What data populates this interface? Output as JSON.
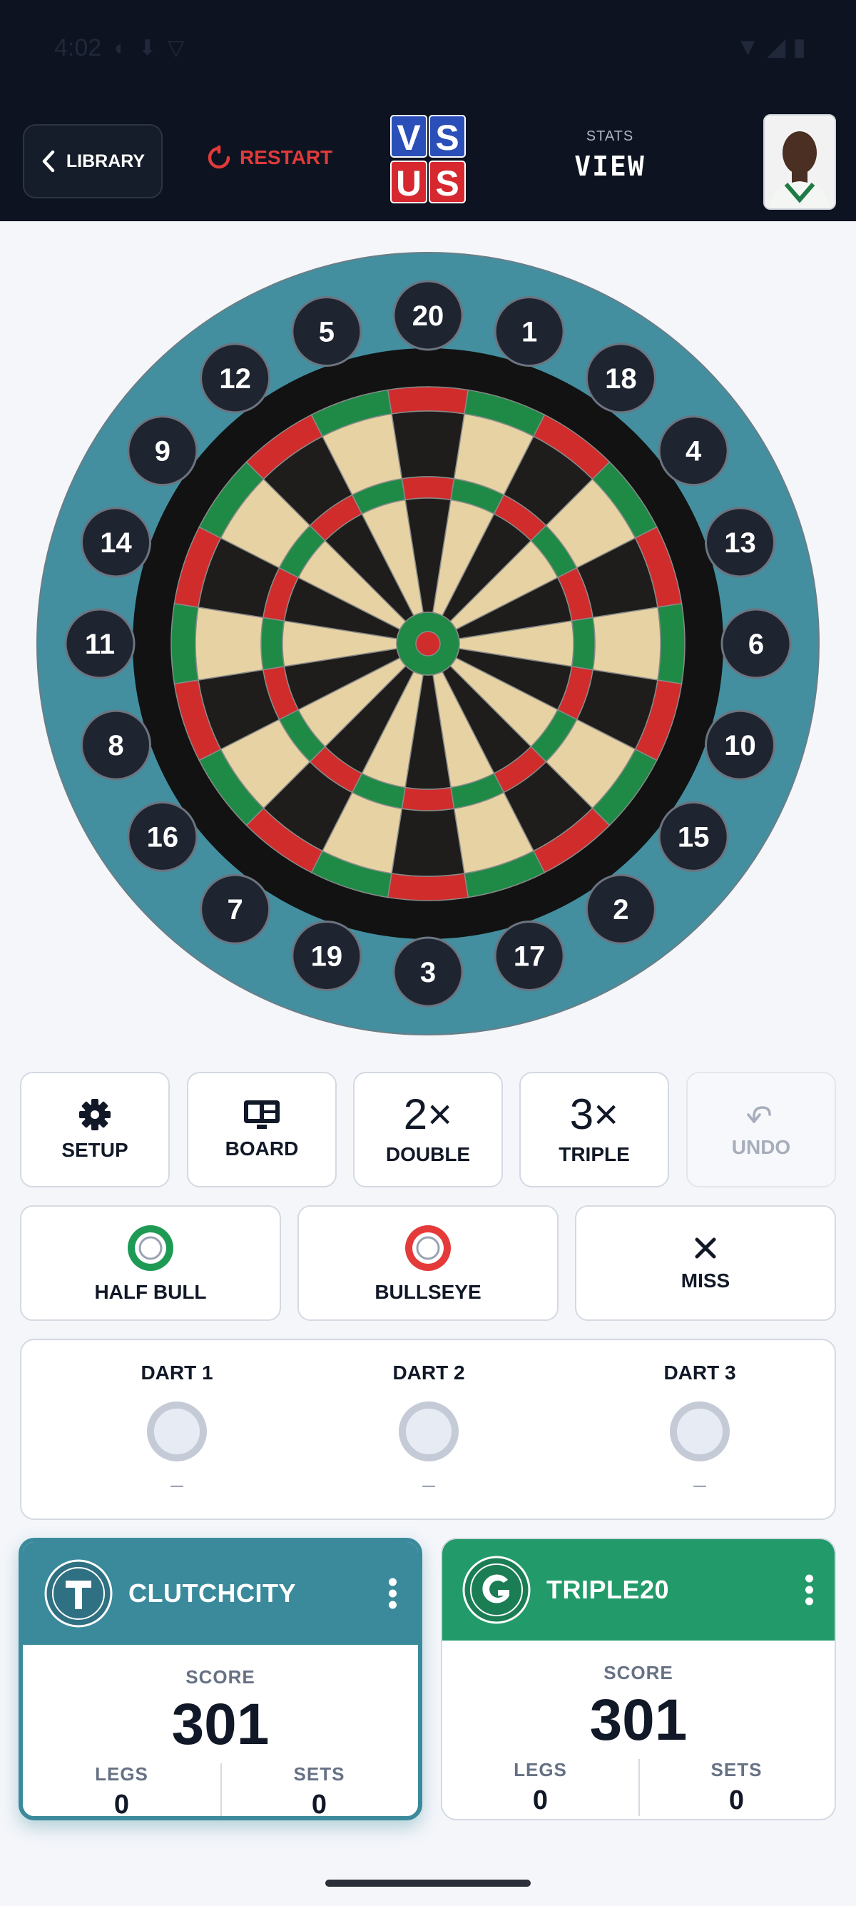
{
  "status_bar": {
    "time": "4:02"
  },
  "topbar": {
    "library_label": "LIBRARY",
    "restart_label": "RESTART",
    "logo_letters": [
      "V",
      "S",
      "U",
      "S"
    ],
    "stats_label": "STATS",
    "stats_value": "VIEW"
  },
  "board": {
    "numbers": [
      20,
      1,
      18,
      4,
      13,
      6,
      10,
      15,
      2,
      17,
      3,
      19,
      7,
      16,
      8,
      11,
      14,
      9,
      12,
      5
    ],
    "colors": {
      "surround": "#438fa0",
      "black_ring": "#121212",
      "dark_segment": "#1e1d1b",
      "light_segment": "#e6d2a3",
      "red": "#d02c2c",
      "green": "#1e8a46",
      "number_disc": "#1e2430"
    }
  },
  "controls": {
    "setup_label": "SETUP",
    "board_label": "BOARD",
    "double_mult": "2×",
    "double_label": "DOUBLE",
    "triple_mult": "3×",
    "triple_label": "TRIPLE",
    "undo_label": "UNDO",
    "half_bull_label": "HALF BULL",
    "bullseye_label": "BULLSEYE",
    "miss_label": "MISS"
  },
  "darts": [
    {
      "label": "DART 1",
      "value": "–"
    },
    {
      "label": "DART 2",
      "value": "–"
    },
    {
      "label": "DART 3",
      "value": "–"
    }
  ],
  "players": [
    {
      "name": "CLUTCHCITY",
      "score_label": "SCORE",
      "score": "301",
      "legs_label": "LEGS",
      "legs": "0",
      "sets_label": "SETS",
      "sets": "0",
      "color": "#3b8a9c",
      "active": true
    },
    {
      "name": "TRIPLE20",
      "score_label": "SCORE",
      "score": "301",
      "legs_label": "LEGS",
      "legs": "0",
      "sets_label": "SETS",
      "sets": "0",
      "color": "#229a69",
      "active": false
    }
  ]
}
